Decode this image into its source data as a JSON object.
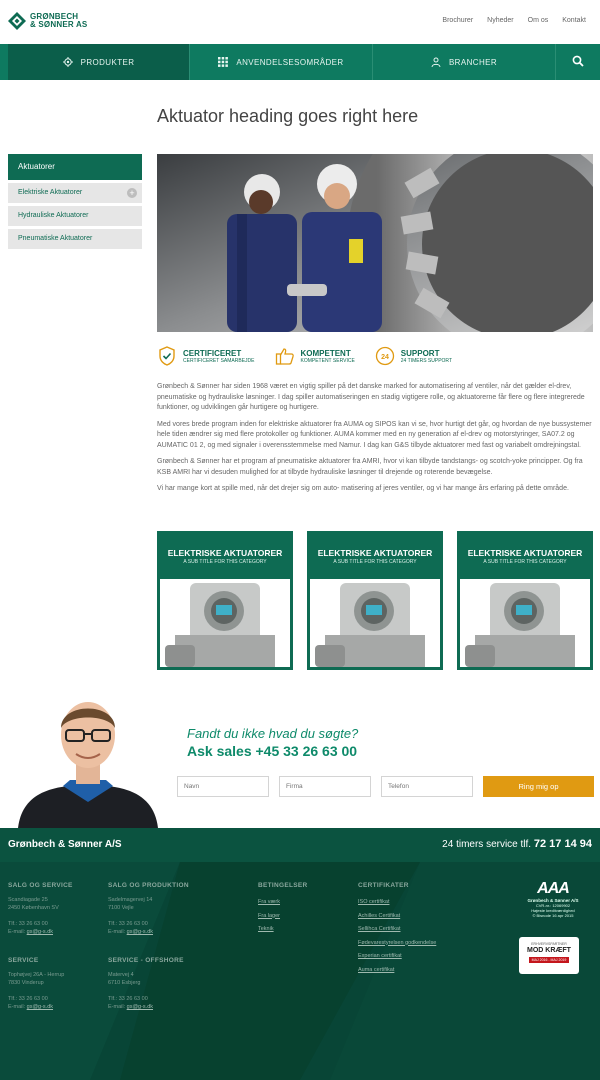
{
  "brand": {
    "line1": "GRØNBECH",
    "line2": "& SØNNER AS",
    "color": "#0e6b53"
  },
  "top_links": [
    "Brochurer",
    "Nyheder",
    "Om os",
    "Kontakt"
  ],
  "nav": [
    {
      "label": "PRODUKTER",
      "icon": "gear-icon"
    },
    {
      "label": "ANVENDELSESOMRÅDER",
      "icon": "grid-icon"
    },
    {
      "label": "BRANCHER",
      "icon": "person-icon"
    }
  ],
  "page_title": "Aktuator heading goes right here",
  "sidebar": {
    "heading": "Aktuatorer",
    "items": [
      "Elektriske Aktuatorer",
      "Hydrauliske Aktuatorer",
      "Pneumatiske Aktuatorer"
    ],
    "expand_symbol": "+"
  },
  "features": [
    {
      "title": "CERTIFICERET",
      "sub": "CERTIFICERET SAMARBEJDE",
      "icon": "shield-check-icon"
    },
    {
      "title": "KOMPETENT",
      "sub": "KOMPETENT SERVICE",
      "icon": "thumbs-up-icon"
    },
    {
      "title": "SUPPORT",
      "sub": "24 TIMERS SUPPORT",
      "icon": "clock-24-icon"
    }
  ],
  "paragraphs": [
    "Grønbech & Sønner har siden 1968 været en vigtig spiller på det danske marked for automatisering af ventiler, når det gælder el-drev, pneumatiske og hydrauliske løsninger. I dag spiller automatiseringen en stadig vigtigere rolle, og aktuatorerne får flere og flere integrerede funktioner, og udviklingen går hurtigere og hurtigere.",
    "Med vores brede program inden for elektriske aktuatorer fra AUMA og SIPOS kan vi se, hvor hurtigt det går, og hvordan de nye bussystemer hele tiden ændrer sig med flere protokoller og funktioner. AUMA kommer med en ny generation af el-drev og motorstyringer, SA07.2 og AUMATIC 01 2, og med signaler i overensstemmelse med Namur. I dag kan G&S tilbyde aktuatorer med fast og variabelt omdrejningstal.",
    "Grønbech & Sønner har et program af pneumatiske aktuatorer fra AMRI, hvor vi kan tilbyde tandstangs- og scotch-yoke principper. Og fra KSB AMRI har vi desuden mulighed for at tilbyde hydrauliske løsninger til drejende og roterende bevægelse.",
    "Vi har mange kort at spille med, når det drejer sig om auto- matisering af jeres ventiler, og vi har mange års erfaring på dette område."
  ],
  "cards": [
    {
      "title": "ELEKTRISKE AKTUATORER",
      "sub": "A SUB TITLE FOR THIS CATEGORY"
    },
    {
      "title": "ELEKTRISKE AKTUATORER",
      "sub": "A SUB TITLE FOR THIS CATEGORY"
    },
    {
      "title": "ELEKTRISKE AKTUATORER",
      "sub": "A SUB TITLE FOR THIS CATEGORY"
    }
  ],
  "contact": {
    "question": "Fandt du ikke hvad du søgte?",
    "phone_line": "Ask sales +45 33 26 63 00",
    "fields": [
      "Navn",
      "Firma",
      "Telefon"
    ],
    "button": "Ring mig op"
  },
  "footer": {
    "company": "Grønbech & Sønner A/S",
    "service_prefix": "24 timers service tlf.",
    "service_phone": "72 17 14 94",
    "col1": {
      "title": "SALG OG SERVICE",
      "addr1": "Scandiagade 25",
      "addr2": "2450 København SV",
      "tlf": "Tlf.: 33 26 63 00",
      "email_prefix": "E-mail: ",
      "email": "gs@g-s.dk"
    },
    "col2": {
      "title": "SALG OG PRODUKTION",
      "addr1": "Sadelmagervej 14",
      "addr2": "7100 Vejle",
      "tlf": "Tlf.: 33 26 63 00",
      "email_prefix": "E-mail: ",
      "email": "gs@g-s.dk"
    },
    "col3": {
      "title": "SERVICE",
      "addr1": "Tophøjvej 26A - Herrup",
      "addr2": "7830 Vinderup",
      "tlf": "Tlf.: 33 26 63 00",
      "email_prefix": "E-mail: ",
      "email": "gs@g-s.dk"
    },
    "col4": {
      "title": "SERVICE - OFFSHORE",
      "addr1": "Matervej 4",
      "addr2": "6710 Esbjerg",
      "tlf": "Tlf.: 33 26 63 00",
      "email_prefix": "E-mail: ",
      "email": "gs@g-s.dk"
    },
    "conditions": {
      "title": "BETINGELSER",
      "links": [
        "Fra værk",
        "Fra lager",
        "Teknik"
      ]
    },
    "certificates": {
      "title": "CERTIFIKATER",
      "links": [
        "ISO certifikat",
        "Achilles Certifikat",
        "Sellihca Certifikat",
        "Fødevarestyrelsen godkendelse",
        "Experian certifikat",
        "Auma certifikat"
      ]
    },
    "aaa": {
      "mark": "AAA",
      "company": "Grønbech & Sønner A/S",
      "cvr": "CVR-nr.: 12069902",
      "l2": "Højeste kreditværdighed",
      "l3": "© Bisnode 16 apr 2015"
    },
    "badge": {
      "l1": "ERHVERVSPARTNER",
      "l2": "MOD KRÆFT",
      "l3": "MAJ 2016 - MAJ 2019"
    }
  }
}
